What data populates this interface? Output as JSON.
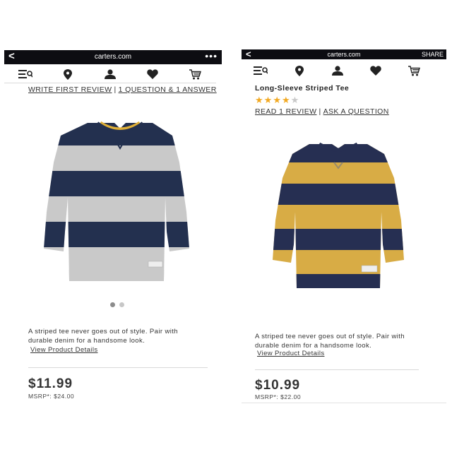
{
  "left": {
    "url_bar": {
      "back": "<",
      "domain": "carters.com",
      "more": "•••"
    },
    "nav_icons": [
      "menu-icon",
      "location-icon",
      "account-icon",
      "heart-icon",
      "cart-icon"
    ],
    "links": {
      "write_review": "WRITE FIRST REVIEW",
      "separator": "|",
      "questions": "1 QUESTION & 1 ANSWER"
    },
    "image": {
      "name": "gray-navy-striped-long-sleeve-tee",
      "colors": {
        "stripe_a": "#c9c9c9",
        "stripe_b": "#23304f",
        "collar": "#e0b038"
      }
    },
    "carousel": {
      "count": 2,
      "active": 0
    },
    "description": {
      "line1": "A striped tee never goes out of style. Pair with",
      "line2": "durable denim for a handsome look."
    },
    "view_details": "View Product Details",
    "price": "$11.99",
    "msrp": "MSRP*: $24.00"
  },
  "right": {
    "url_bar": {
      "back": "<",
      "domain": "carters.com",
      "share": "SHARE"
    },
    "nav_icons": [
      "menu-icon",
      "location-icon",
      "account-icon",
      "heart-icon",
      "cart-icon"
    ],
    "title": "Long-Sleeve Striped Tee",
    "rating": {
      "value": 4,
      "max": 5
    },
    "links": {
      "read_review": "READ 1 REVIEW",
      "separator": "|",
      "ask": "ASK A QUESTION"
    },
    "image": {
      "name": "yellow-navy-striped-long-sleeve-tee",
      "colors": {
        "stripe_a": "#d8ac45",
        "stripe_b": "#262f52"
      }
    },
    "description": {
      "line1": "A striped tee never goes out of style. Pair with",
      "line2": "durable denim for a handsome look."
    },
    "view_details": "View Product Details",
    "price": "$10.99",
    "msrp": "MSRP*: $22.00"
  },
  "colors": {
    "url_bar_bg": "#0d0d12",
    "star": "#f2a922",
    "text": "#333333"
  }
}
